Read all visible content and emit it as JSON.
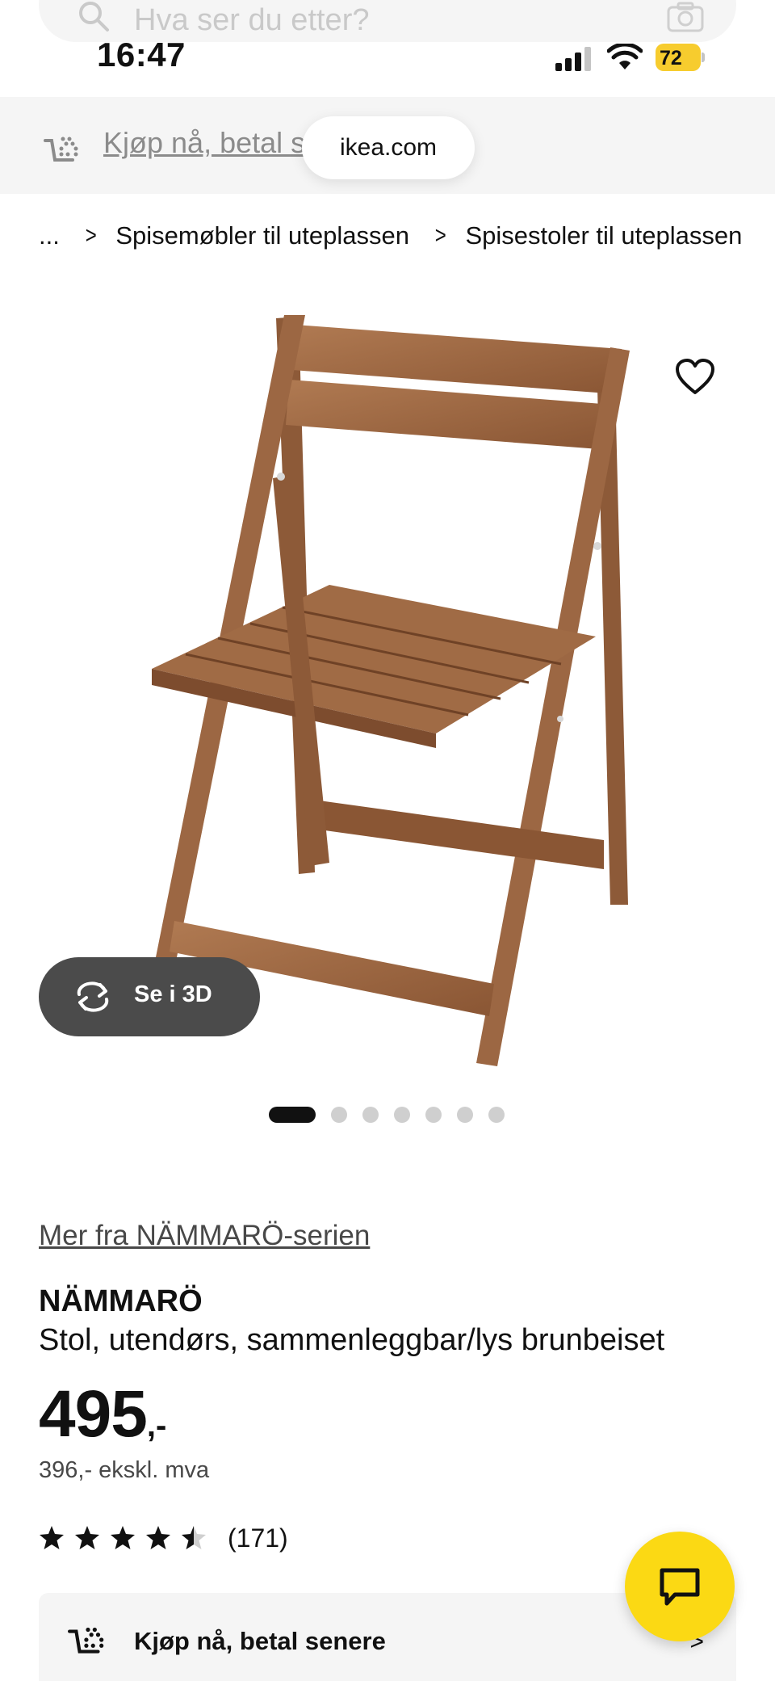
{
  "search": {
    "placeholder": "Hva ser du etter?"
  },
  "status_bar": {
    "time": "16:47",
    "battery": "72"
  },
  "promo_strip": {
    "text": "Kjøp nå, betal s"
  },
  "browser": {
    "url": "ikea.com"
  },
  "breadcrumb": {
    "ellipsis": "...",
    "items": [
      "Spisemøbler til uteplassen",
      "Spisestoler til uteplassen"
    ]
  },
  "media": {
    "view_3d_label": "Se i 3D",
    "image_count": 7,
    "active_index": 0
  },
  "product": {
    "series_link": "Mer fra NÄMMARÖ-serien",
    "name": "NÄMMARÖ",
    "description": "Stol, utendørs, sammenleggbar/lys brunbeiset",
    "price": "495",
    "price_suffix": ",-",
    "price_ex_vat": "396,- ekskl. mva",
    "rating": 4.5,
    "rating_count": "(171)"
  },
  "bnpl": {
    "label": "Kjøp nå, betal senere"
  },
  "colors": {
    "ikea_yellow": "#fbd914",
    "wood": "#9c6743",
    "chip_dark": "#4b4b4b"
  },
  "icons": [
    "search-icon",
    "camera-icon",
    "signal-icon",
    "wifi-icon",
    "cart-icon",
    "heart-icon",
    "rotate-3d-icon",
    "star-icon",
    "chat-icon",
    "chevron-right-icon"
  ]
}
